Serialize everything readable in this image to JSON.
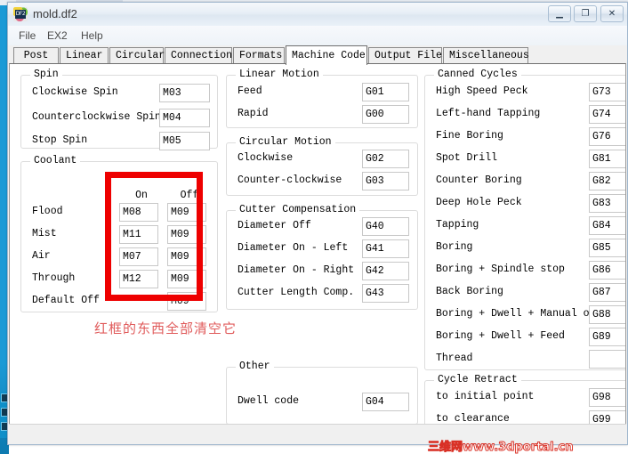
{
  "window": {
    "title": "mold.df2",
    "icon": "df2-file-icon",
    "buttons": {
      "minimize": "—",
      "maximize": "❐",
      "close": "✕"
    }
  },
  "menu": {
    "items": [
      "File",
      "EX2",
      "Help"
    ]
  },
  "tabs": [
    {
      "label": "Post",
      "active": false
    },
    {
      "label": "Linear",
      "active": false
    },
    {
      "label": "Circular",
      "active": false
    },
    {
      "label": "Connection",
      "active": false
    },
    {
      "label": "Formats",
      "active": false
    },
    {
      "label": "Machine Code",
      "active": true
    },
    {
      "label": "Output Files",
      "active": false
    },
    {
      "label": "Miscellaneous",
      "active": false
    }
  ],
  "groups": {
    "spin": {
      "title": "Spin",
      "rows": [
        {
          "label": "Clockwise Spin",
          "value": "M03"
        },
        {
          "label": "Counterclockwise Spin",
          "value": "M04"
        },
        {
          "label": "Stop Spin",
          "value": "M05"
        }
      ]
    },
    "coolant": {
      "title": "Coolant",
      "col_on": "On",
      "col_off": "Off",
      "rows": [
        {
          "label": "Flood",
          "on": "M08",
          "off": "M09"
        },
        {
          "label": "Mist",
          "on": "M11",
          "off": "M09"
        },
        {
          "label": "Air",
          "on": "M07",
          "off": "M09"
        },
        {
          "label": "Through",
          "on": "M12",
          "off": "M09"
        },
        {
          "label": "Default Off",
          "on": null,
          "off": "M09"
        }
      ]
    },
    "linear_motion": {
      "title": "Linear Motion",
      "rows": [
        {
          "label": "Feed",
          "value": "G01"
        },
        {
          "label": "Rapid",
          "value": "G00"
        }
      ]
    },
    "circular_motion": {
      "title": "Circular Motion",
      "rows": [
        {
          "label": "Clockwise",
          "value": "G02"
        },
        {
          "label": "Counter-clockwise",
          "value": "G03"
        }
      ]
    },
    "cutter_compensation": {
      "title": "Cutter Compensation",
      "rows": [
        {
          "label": "Diameter Off",
          "value": "G40"
        },
        {
          "label": "Diameter On - Left",
          "value": "G41"
        },
        {
          "label": "Diameter On - Right",
          "value": "G42"
        },
        {
          "label": "Cutter Length Comp.",
          "value": "G43"
        }
      ]
    },
    "other": {
      "title": "Other",
      "rows": [
        {
          "label": "Dwell code",
          "value": "G04"
        }
      ]
    },
    "canned_cycles": {
      "title": "Canned Cycles",
      "rows": [
        {
          "label": "High Speed Peck",
          "value": "G73"
        },
        {
          "label": "Left-hand Tapping",
          "value": "G74"
        },
        {
          "label": "Fine Boring",
          "value": "G76"
        },
        {
          "label": "Spot Drill",
          "value": "G81"
        },
        {
          "label": "Counter Boring",
          "value": "G82"
        },
        {
          "label": "Deep Hole Peck",
          "value": "G83"
        },
        {
          "label": "Tapping",
          "value": "G84"
        },
        {
          "label": "Boring",
          "value": "G85"
        },
        {
          "label": "Boring + Spindle stop",
          "value": "G86"
        },
        {
          "label": "Back Boring",
          "value": "G87"
        },
        {
          "label": "Boring + Dwell + Manual out",
          "value": "G88"
        },
        {
          "label": "Boring + Dwell + Feed",
          "value": "G89"
        },
        {
          "label": "Thread",
          "value": ""
        }
      ]
    },
    "cycle_retract": {
      "title": "Cycle Retract",
      "rows": [
        {
          "label": "to initial point",
          "value": "G98"
        },
        {
          "label": "to clearance",
          "value": "G99"
        }
      ]
    }
  },
  "annotation": {
    "text": "红框的东西全部清空它",
    "color": "#e05b5b"
  },
  "highlight_box": {
    "color": "#ee0000"
  },
  "watermark": {
    "text": "三维网www.3dportal.cn",
    "color": "#d93025"
  }
}
